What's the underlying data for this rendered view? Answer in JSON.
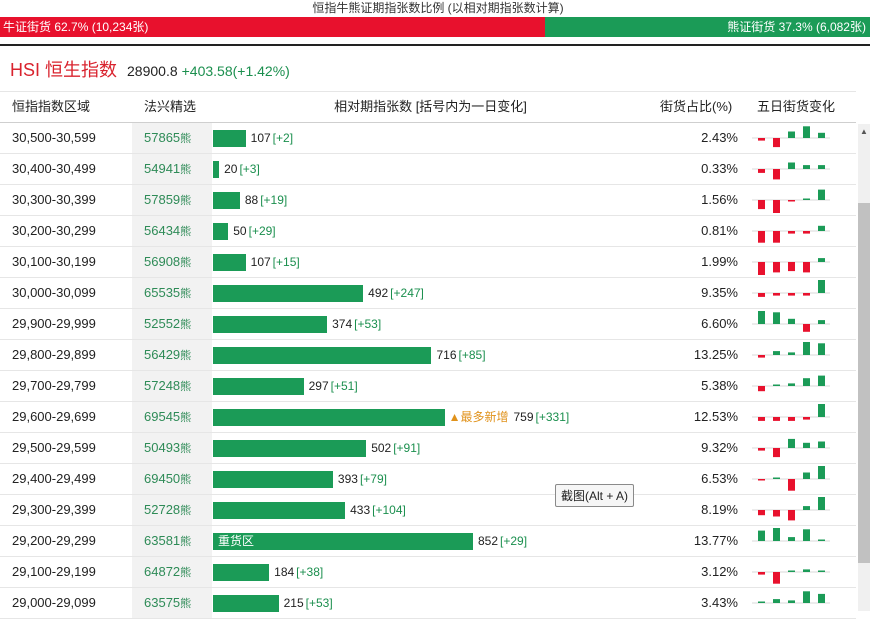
{
  "header": {
    "title": "恒指牛熊证期指张数比例 (以相对期指张数计算)",
    "bull_label": "牛证街货 62.7% (10,234张)",
    "bear_label": "熊证街货 37.3% (6,082张)",
    "bull_pct": 62.7
  },
  "index": {
    "name": "HSI 恒生指数",
    "price": "28900.8",
    "change": "+403.58(+1.42%)"
  },
  "columns": {
    "range": "恒指指数区域",
    "code": "法兴精选",
    "bars": "相对期指张数 [括号内为一日变化]",
    "share": "街货占比(%)",
    "mini": "五日街货变化"
  },
  "colors": {
    "bull": "#e8112d",
    "bear": "#1b9b57"
  },
  "rows": [
    {
      "range": "30,500-30,599",
      "code": "57865",
      "suffix": "熊",
      "value": 107,
      "change": "[+2]",
      "share": "2.43%",
      "bar_label": "",
      "tag": "",
      "mini": [
        -0.2,
        -0.7,
        0.5,
        0.9,
        0.4
      ]
    },
    {
      "range": "30,400-30,499",
      "code": "54941",
      "suffix": "熊",
      "value": 20,
      "change": "[+3]",
      "share": "0.33%",
      "bar_label": "",
      "tag": "",
      "mini": [
        -0.3,
        -0.8,
        0.5,
        0.3,
        0.3
      ]
    },
    {
      "range": "30,300-30,399",
      "code": "57859",
      "suffix": "熊",
      "value": 88,
      "change": "[+19]",
      "share": "1.56%",
      "bar_label": "",
      "tag": "",
      "mini": [
        -0.7,
        -1.0,
        -0.1,
        0.1,
        0.8
      ]
    },
    {
      "range": "30,200-30,299",
      "code": "56434",
      "suffix": "熊",
      "value": 50,
      "change": "[+29]",
      "share": "0.81%",
      "bar_label": "",
      "tag": "",
      "mini": [
        -0.9,
        -0.9,
        -0.2,
        -0.2,
        0.4
      ]
    },
    {
      "range": "30,100-30,199",
      "code": "56908",
      "suffix": "熊",
      "value": 107,
      "change": "[+15]",
      "share": "1.99%",
      "bar_label": "",
      "tag": "",
      "mini": [
        -1.0,
        -0.8,
        -0.7,
        -0.8,
        0.3
      ]
    },
    {
      "range": "30,000-30,099",
      "code": "65535",
      "suffix": "熊",
      "value": 492,
      "change": "[+247]",
      "share": "9.35%",
      "bar_label": "",
      "tag": "",
      "mini": [
        -0.3,
        -0.2,
        -0.2,
        -0.2,
        1.0
      ]
    },
    {
      "range": "29,900-29,999",
      "code": "52552",
      "suffix": "熊",
      "value": 374,
      "change": "[+53]",
      "share": "6.60%",
      "bar_label": "",
      "tag": "",
      "mini": [
        1.0,
        0.9,
        0.4,
        -0.6,
        0.3
      ]
    },
    {
      "range": "29,800-29,899",
      "code": "56429",
      "suffix": "熊",
      "value": 716,
      "change": "[+85]",
      "share": "13.25%",
      "bar_label": "",
      "tag": "",
      "mini": [
        -0.2,
        0.3,
        0.2,
        1.0,
        0.9
      ]
    },
    {
      "range": "29,700-29,799",
      "code": "57248",
      "suffix": "熊",
      "value": 297,
      "change": "[+51]",
      "share": "5.38%",
      "bar_label": "",
      "tag": "",
      "mini": [
        -0.4,
        0.1,
        0.2,
        0.6,
        0.8
      ]
    },
    {
      "range": "29,600-29,699",
      "code": "69545",
      "suffix": "熊",
      "value": 759,
      "change": "[+331]",
      "share": "12.53%",
      "bar_label": "",
      "tag": "▲最多新增",
      "mini": [
        -0.3,
        -0.3,
        -0.3,
        -0.2,
        1.0
      ]
    },
    {
      "range": "29,500-29,599",
      "code": "50493",
      "suffix": "熊",
      "value": 502,
      "change": "[+91]",
      "share": "9.32%",
      "bar_label": "",
      "tag": "",
      "mini": [
        -0.2,
        -0.7,
        0.7,
        0.4,
        0.5
      ]
    },
    {
      "range": "29,400-29,499",
      "code": "69450",
      "suffix": "熊",
      "value": 393,
      "change": "[+79]",
      "share": "6.53%",
      "bar_label": "",
      "tag": "",
      "mini": [
        -0.1,
        0.1,
        -0.9,
        0.5,
        1.0
      ]
    },
    {
      "range": "29,300-29,399",
      "code": "52728",
      "suffix": "熊",
      "value": 433,
      "change": "[+104]",
      "share": "8.19%",
      "bar_label": "",
      "tag": "",
      "mini": [
        -0.4,
        -0.5,
        -0.8,
        0.3,
        1.0
      ]
    },
    {
      "range": "29,200-29,299",
      "code": "63581",
      "suffix": "熊",
      "value": 852,
      "change": "[+29]",
      "share": "13.77%",
      "bar_label": "重货区",
      "tag": "",
      "mini": [
        0.8,
        1.0,
        0.3,
        0.9,
        0.1
      ]
    },
    {
      "range": "29,100-29,199",
      "code": "64872",
      "suffix": "熊",
      "value": 184,
      "change": "[+38]",
      "share": "3.12%",
      "bar_label": "",
      "tag": "",
      "mini": [
        -0.2,
        -0.9,
        0.1,
        0.2,
        0.1
      ]
    },
    {
      "range": "29,000-29,099",
      "code": "63575",
      "suffix": "熊",
      "value": 215,
      "change": "[+53]",
      "share": "3.43%",
      "bar_label": "",
      "tag": "",
      "mini": [
        0.1,
        0.3,
        0.2,
        0.9,
        0.7
      ]
    }
  ],
  "tooltip": "截图(Alt + A)"
}
